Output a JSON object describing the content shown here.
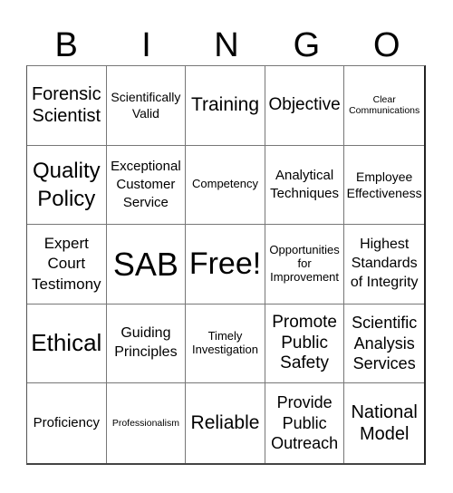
{
  "title_letters": [
    "B",
    "I",
    "N",
    "G",
    "O"
  ],
  "cells": [
    [
      "Forensic Scientist",
      "Scientifically Valid",
      "Training",
      "Objective",
      "Clear Communications"
    ],
    [
      "Quality Policy",
      "Exceptional Customer Service",
      "Competency",
      "Analytical Techniques",
      "Employee Effectiveness"
    ],
    [
      "Expert Court Testimony",
      "SAB",
      "Free!",
      "Opportunities for Improvement",
      "Highest Standards of Integrity"
    ],
    [
      "Ethical",
      "Guiding Principles",
      "Timely Investigation",
      "Promote Public Safety",
      "Scientific Analysis Services"
    ],
    [
      "Proficiency",
      "Professionalism",
      "Reliable",
      "Provide Public Outreach",
      "National Model"
    ]
  ]
}
